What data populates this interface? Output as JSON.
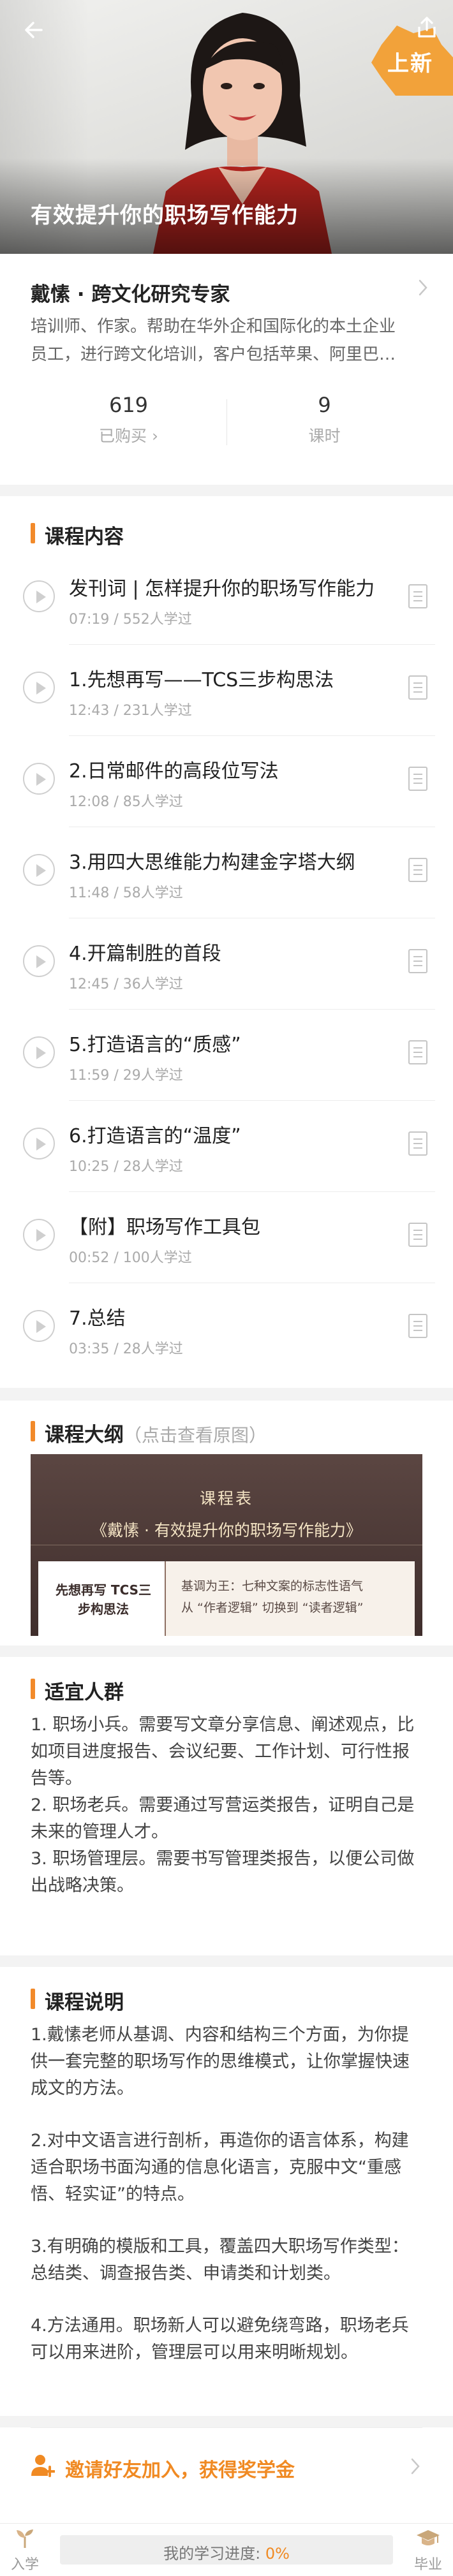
{
  "hero": {
    "title": "有效提升你的职场写作能力",
    "badge": "上新"
  },
  "instructor": {
    "name": "戴愫 · 跨文化研究专家",
    "desc_line1": "培训师、作家。帮助在华外企和国际化的本土企业",
    "desc_line2": "员工，进行跨文化培训，客户包括苹果、阿里巴…",
    "purchased_count": "619",
    "purchased_label": "已购买 ›",
    "lesson_count": "9",
    "lesson_label": "课时"
  },
  "lessons": {
    "heading": "课程内容",
    "items": [
      {
        "title": "发刊词 | 怎样提升你的职场写作能力",
        "meta": "07:19 / 552人学过"
      },
      {
        "title": "1.先想再写——TCS三步构思法",
        "meta": "12:43 / 231人学过"
      },
      {
        "title": "2.日常邮件的高段位写法",
        "meta": "12:08 / 85人学过"
      },
      {
        "title": "3.用四大思维能力构建金字塔大纲",
        "meta": "11:48 / 58人学过"
      },
      {
        "title": "4.开篇制胜的首段",
        "meta": "12:45 / 36人学过"
      },
      {
        "title": "5.打造语言的“质感”",
        "meta": "11:59 / 29人学过"
      },
      {
        "title": "6.打造语言的“温度”",
        "meta": "10:25 / 28人学过"
      },
      {
        "title": "【附】职场写作工具包",
        "meta": "00:52 / 100人学过"
      },
      {
        "title": "7.总结",
        "meta": "03:35 / 28人学过"
      }
    ]
  },
  "outline": {
    "heading": "课程大纲",
    "hint": "（点击查看原图）",
    "img_title1": "课程表",
    "img_title2": "《戴愫 · 有效提升你的职场写作能力》",
    "img_cell_left": "先想再写 TCS三步构思法",
    "img_cell_right_1": "基调为王：七种文案的标志性语气",
    "img_cell_right_2": "从 “作者逻辑” 切换到 “读者逻辑”"
  },
  "audience": {
    "heading": "适宜人群",
    "p1": "1. 职场小兵。需要写文章分享信息、阐述观点，比如项目进度报告、会议纪要、工作计划、可行性报告等。",
    "p2": "2. 职场老兵。需要通过写营运类报告，证明自己是未来的管理人才。",
    "p3": "3. 职场管理层。需要书写管理类报告，以便公司做出战略决策。"
  },
  "description": {
    "heading": "课程说明",
    "p1": "1.戴愫老师从基调、内容和结构三个方面，为你提供一套完整的职场写作的思维模式，让你掌握快速成文的方法。",
    "p2": "2.对中文语言进行剖析，再造你的语言体系，构建适合职场书面沟通的信息化语言，克服中文“重感悟、轻实证”的特点。",
    "p3": "3.有明确的模版和工具，覆盖四大职场写作类型：总结类、调查报告类、申请类和计划类。",
    "p4": "4.方法通用。职场新人可以避免绕弯路，职场老兵可以用来进阶，管理层可以用来明晰规划。"
  },
  "invite": {
    "text": "邀请好友加入，获得奖学金"
  },
  "bottom": {
    "start_label": "入学",
    "end_label": "毕业",
    "progress_label": "我的学习进度: ",
    "progress_value": "0%",
    "progress_fraction": 0
  },
  "colors": {
    "accent": "#f28a2a",
    "progress_fill": "#f9c78c"
  }
}
